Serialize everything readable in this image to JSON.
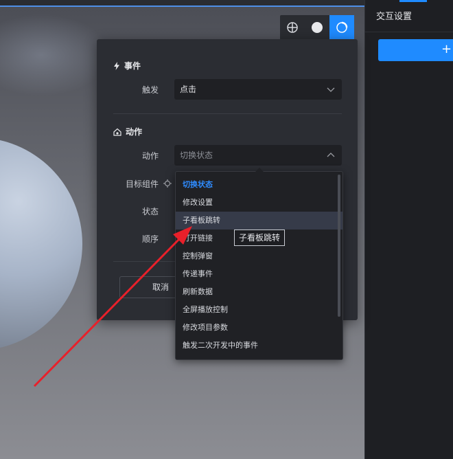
{
  "side_panel": {
    "title": "交互设置",
    "add_button_label": "+",
    "accent_color": "#1f8bff"
  },
  "view_toolbar": {
    "buttons": [
      {
        "icon": "globe-icon",
        "active": false
      },
      {
        "icon": "solid-circle-icon",
        "active": false
      },
      {
        "icon": "rotate-circle-icon",
        "active": true
      }
    ]
  },
  "dialog": {
    "event_section": {
      "title": "事件",
      "icon": "lightning-icon",
      "trigger_label": "触发",
      "trigger_value": "点击"
    },
    "action_section": {
      "title": "动作",
      "icon": "action-icon",
      "action_label": "动作",
      "action_placeholder": "切换状态",
      "target_label": "目标组件",
      "state_label": "状态",
      "order_label": "顺序"
    },
    "cancel_label": "取消"
  },
  "dropdown": {
    "options": [
      "切换状态",
      "修改设置",
      "子看板跳转",
      "打开链接",
      "控制弹窗",
      "传递事件",
      "刷新数据",
      "全屏播放控制",
      "修改项目参数",
      "触发二次开发中的事件"
    ],
    "selected_option": "切换状态",
    "hovered_option": "子看板跳转"
  },
  "tooltip": {
    "text": "子看板跳转"
  },
  "annotation": {
    "color": "#e8202a"
  }
}
